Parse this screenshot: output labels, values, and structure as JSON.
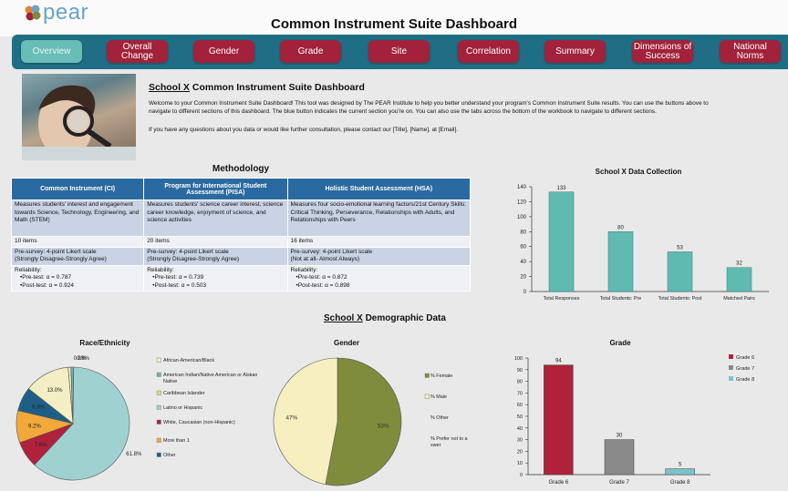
{
  "header": {
    "logo_text": "pear",
    "title": "Common Instrument Suite Dashboard"
  },
  "nav": {
    "items": [
      {
        "label": "Overview",
        "active": true
      },
      {
        "label": "Overall Change"
      },
      {
        "label": "Gender"
      },
      {
        "label": "Grade"
      },
      {
        "label": "Site"
      },
      {
        "label": "Correlation"
      },
      {
        "label": "Summary"
      },
      {
        "label": "Dimensions of Success"
      },
      {
        "label": "National Norms"
      }
    ],
    "active_color": "#68bdb6",
    "button_color": "#a1223a",
    "bar_color": "#1f6e85"
  },
  "intro": {
    "school": "School X",
    "heading_rest": " Common Instrument Suite Dashboard",
    "line1": "Welcome to your Common Instrument Suite Dashboard! This tool was designed by The PEAR Institute to help you better understand your program's Common Instrument Suite results. You can use the buttons above to",
    "line2": "navigate to different sections of this dashboard. The blue button indicates the current section you're on. You can also use the tabs across the bottom of the workbook to navigate to different sections.",
    "line3": "If you have any questions about you data or would like further consultation, please contact our [Title], [Name], at [Email]."
  },
  "methodology": {
    "title": "Methodology",
    "columns": [
      {
        "header": "Common Instrument (CI)",
        "description": "Measures students' interest and engagement towards Science, Technology, Engineering, and Math (STEM)",
        "items": "10 items",
        "scale_1": "Pre-survey: 4-point Likert scale",
        "scale_2": "(Strongly Disagree-Strongly Agree)",
        "reliability": "Reliability:",
        "pre": "•Pre-test: α = 0.787",
        "post": "•Post-test: α = 0.924"
      },
      {
        "header": "Program for International Student Assessment (PISA)",
        "description": "Measures students' science career interest, science career knowledge, enjoyment of science, and science activities",
        "items": "20 items",
        "scale_1": "Pre-survey: 4-point Likert scale",
        "scale_2": "(Strongly Disagree-Strongly Agree)",
        "reliability": "Reliability:",
        "pre": "•Pre-test: α = 0.739",
        "post": "•Post-test: α = 0.503"
      },
      {
        "header": "Holistic Student Assessment (HSA)",
        "description": "Measures four socio-emotional learning factors/21st Century Skills: Critical Thinking, Perseverance, Relationships with Adults, and Relationships with Peers",
        "items": "16 items",
        "scale_1": "Pre-survey: 4-point Likert scale",
        "scale_2": "(Not at all- Almost Always)",
        "reliability": "Reliability:",
        "pre": "•Pre-test: α = 0.872",
        "post": "•Post-test: α = 0.898"
      }
    ]
  },
  "demographics": {
    "school": "School X",
    "heading_rest": " Demographic Data"
  },
  "chart_data": [
    {
      "type": "bar",
      "title": "School X Data Collection",
      "categories": [
        "Total Responses",
        "Total Students: Pre",
        "Total Students: Post",
        "Matched Pairs"
      ],
      "values": [
        133,
        80,
        53,
        32
      ],
      "ylim": [
        0,
        140
      ],
      "yticks": [
        0,
        20,
        40,
        60,
        80,
        100,
        120,
        140
      ],
      "color": "#5fbab1"
    },
    {
      "type": "pie",
      "title": "Race/Ethnicity",
      "slices": [
        {
          "label": "African-American/Black",
          "value": 0.8,
          "text": "0.8%",
          "color": "#f4eec4"
        },
        {
          "label": "American Indian/Native American or Alskan Native",
          "value": 0.8,
          "text": "0.8%",
          "color": "#6fb3a8"
        },
        {
          "label": "Caribbean Islander",
          "value": 0.0,
          "text": "",
          "color": "#e5d77a"
        },
        {
          "label": "Latino or Hispanic",
          "value": 61.8,
          "text": "61.8%",
          "color": "#9fd1d0"
        },
        {
          "label": "White, Caucasian (non-Hispanic)",
          "value": 7.6,
          "text": "7.6%",
          "color": "#b0213c"
        },
        {
          "label": "More than 1",
          "value": 9.2,
          "text": "9.2%",
          "color": "#f2a93a"
        },
        {
          "label": "Other",
          "value": 6.9,
          "text": "6.9%",
          "color": "#1d5f86"
        },
        {
          "label": "",
          "value": 13.0,
          "text": "13.0%",
          "color": "#f4eec4"
        }
      ]
    },
    {
      "type": "pie",
      "title": "Gender",
      "slices": [
        {
          "label": "% Female",
          "value": 53,
          "text": "53%",
          "color": "#7f8c3c"
        },
        {
          "label": "% Male",
          "value": 47,
          "text": "47%",
          "color": "#f6efbf"
        },
        {
          "label": "% Other",
          "value": 0,
          "text": "",
          "color": "#cccccc"
        },
        {
          "label": "% Prefer not to answer",
          "value": 0,
          "text": "",
          "color": "#bbbbbb"
        }
      ]
    },
    {
      "type": "bar",
      "title": "Grade",
      "categories": [
        "Grade 6",
        "Grade 7",
        "Grade 8"
      ],
      "values": [
        94,
        30,
        5
      ],
      "colors": [
        "#b0213c",
        "#8a8a8a",
        "#79c3cc"
      ],
      "legend": [
        "Grade 6",
        "Grade 7",
        "Grade 8"
      ],
      "ylim": [
        0,
        100
      ],
      "yticks": [
        0,
        10,
        20,
        30,
        40,
        50,
        60,
        70,
        80,
        90,
        100
      ]
    }
  ]
}
